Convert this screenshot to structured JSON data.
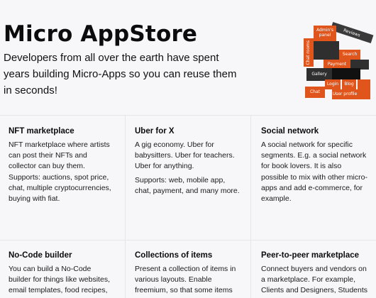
{
  "hero": {
    "title": "Micro AppStore",
    "subtitle": "Developers from all over the earth have spent years building Micro-Apps so you can reuse them in seconds!",
    "illustration": {
      "labels": [
        "Reviews",
        "Admin's panel",
        "Search",
        "Chat rooms",
        "Payment",
        "Gallery",
        "Login",
        "Blog",
        "Chat",
        "User profile"
      ],
      "colors": {
        "orange": "#e0551c",
        "dark": "#2f2f2f",
        "black": "#111111"
      }
    }
  },
  "cards": [
    {
      "title": "NFT marketplace",
      "paragraphs": [
        "NFT marketplace where artists can post their NFTs and collector can buy them. Supports: auctions, spot price, chat, multiple cryptocurrencies, buying with fiat."
      ]
    },
    {
      "title": "Uber for X",
      "paragraphs": [
        "A gig economy. Uber for babysitters. Uber for teachers. Uber for anything.",
        "Supports: web, mobile app, chat, payment, and many more."
      ]
    },
    {
      "title": "Social network",
      "paragraphs": [
        "A social network for specific segments. E.g. a social network for book lovers. It is also possible to mix with other micro-apps and add e-commerce, for example."
      ]
    },
    {
      "title": "No-Code builder",
      "paragraphs": [
        "You can build a No-Code builder for things like websites, email templates, food recipes, house design"
      ]
    },
    {
      "title": "Collections of items",
      "paragraphs": [
        "Present a collection of items in various layouts. Enable freemium, so that some items can be seen for free"
      ]
    },
    {
      "title": "Peer-to-peer marketplace",
      "paragraphs": [
        "Connect buyers and vendors on a marketplace. For example, Clients and Designers, Students and"
      ]
    }
  ]
}
